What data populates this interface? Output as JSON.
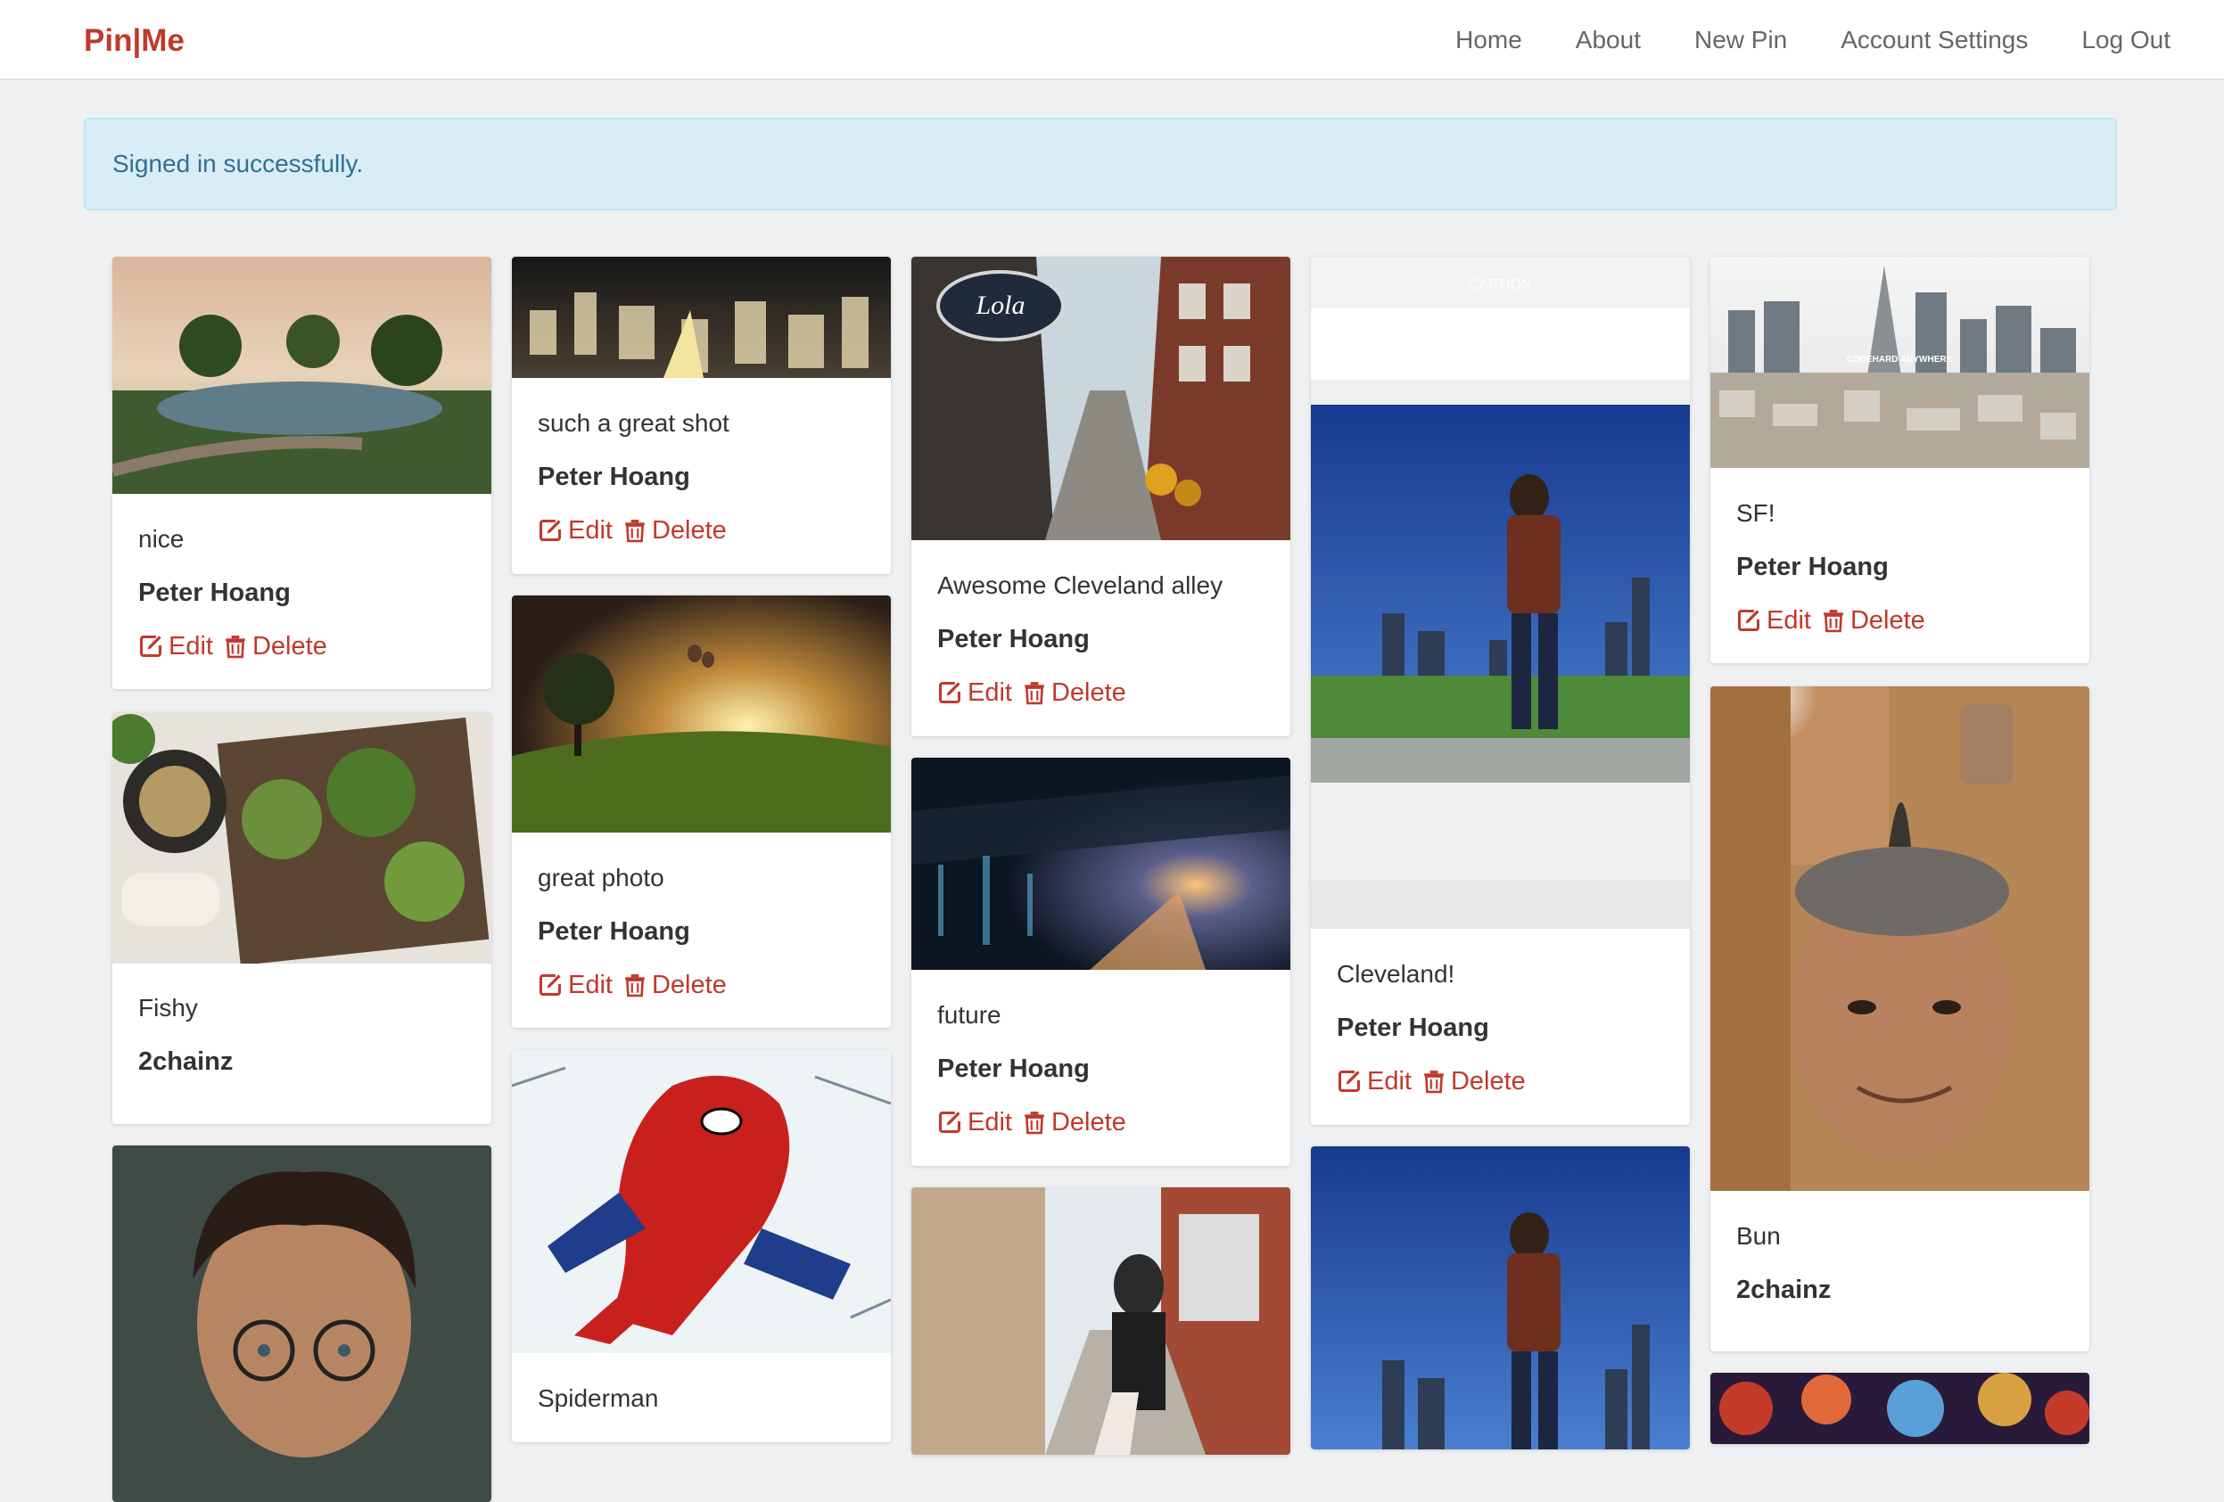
{
  "app": {
    "brand": "Pin|Me"
  },
  "nav": {
    "home": "Home",
    "about": "About",
    "new_pin": "New Pin",
    "account_settings": "Account Settings",
    "log_out": "Log Out"
  },
  "flash": {
    "message": "Signed in successfully."
  },
  "colors": {
    "brand": "#c0392b",
    "alert_bg": "#d9edf7",
    "alert_text": "#31708f",
    "page_bg": "#eff0f1"
  },
  "actions": {
    "edit": "Edit",
    "delete": "Delete",
    "edit_icon": "edit-icon",
    "delete_icon": "trash-icon"
  },
  "pins": [
    {
      "description": "nice",
      "user": "Peter Hoang",
      "image": "park-landscape"
    },
    {
      "description": "Fishy",
      "user": "2chainz",
      "image": "food-platter"
    },
    {
      "description": "",
      "user": "",
      "image": "portrait-boy-glasses"
    },
    {
      "description": "such a great shot",
      "user": "Peter Hoang",
      "image": "city-night"
    },
    {
      "description": "great photo",
      "user": "Peter Hoang",
      "image": "tree-sunset"
    },
    {
      "description": "Spiderman",
      "user": "",
      "image": "spiderman-comic"
    },
    {
      "description": "Awesome Cleveland alley",
      "user": "Peter Hoang",
      "image": "alley-street"
    },
    {
      "description": "future",
      "user": "Peter Hoang",
      "image": "scifi-city"
    },
    {
      "description": "",
      "user": "",
      "image": "couple-street"
    },
    {
      "description": "Cleveland!",
      "user": "Peter Hoang",
      "image": "man-skyline-screenshot",
      "caption_overlay": "CAPTION"
    },
    {
      "description": "",
      "user": "",
      "image": "man-skyline"
    },
    {
      "description": "SF!",
      "user": "Peter Hoang",
      "image": "sf-skyline",
      "image_text": "CODEHARD ANYWHERE"
    },
    {
      "description": "Bun",
      "user": "2chainz",
      "image": "selfie-man"
    },
    {
      "description": "",
      "user": "",
      "image": "fantasy-art"
    }
  ]
}
